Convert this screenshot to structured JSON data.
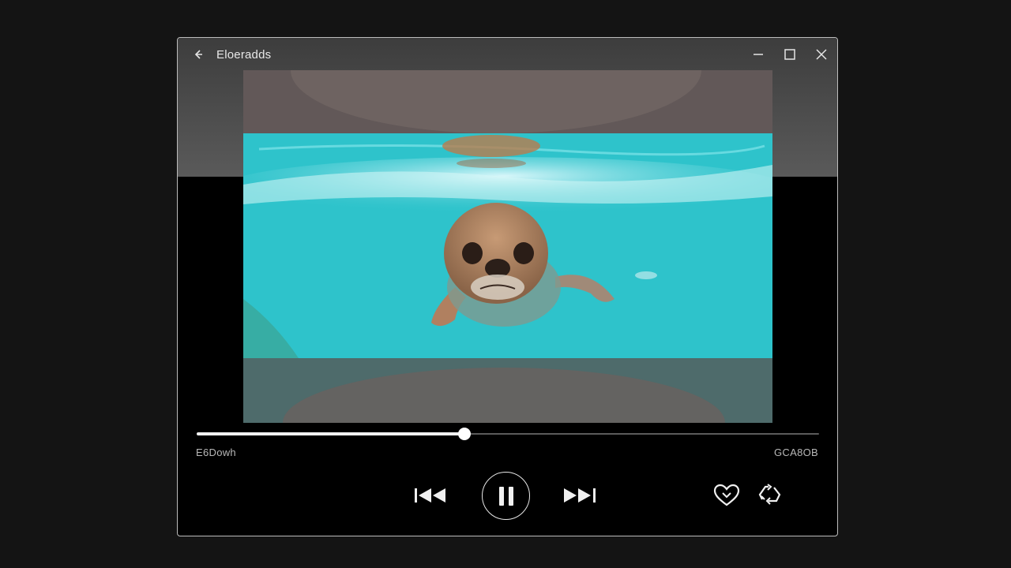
{
  "window": {
    "title": "Eloeradds"
  },
  "player": {
    "elapsed": "E6Dowh",
    "total": "GCA8OB",
    "progress_fraction": 0.43
  },
  "icons": {
    "back": "back-arrow-icon",
    "minimize": "minimize-icon",
    "maximize": "maximize-icon",
    "close": "close-icon",
    "previous": "skip-previous-icon",
    "pause": "pause-icon",
    "next": "skip-next-icon",
    "like": "heart-icon",
    "repeat": "repeat-icon"
  },
  "colors": {
    "accent": "#ffffff",
    "water": "#2ec4cc",
    "frame_border": "#bdbdbd"
  }
}
